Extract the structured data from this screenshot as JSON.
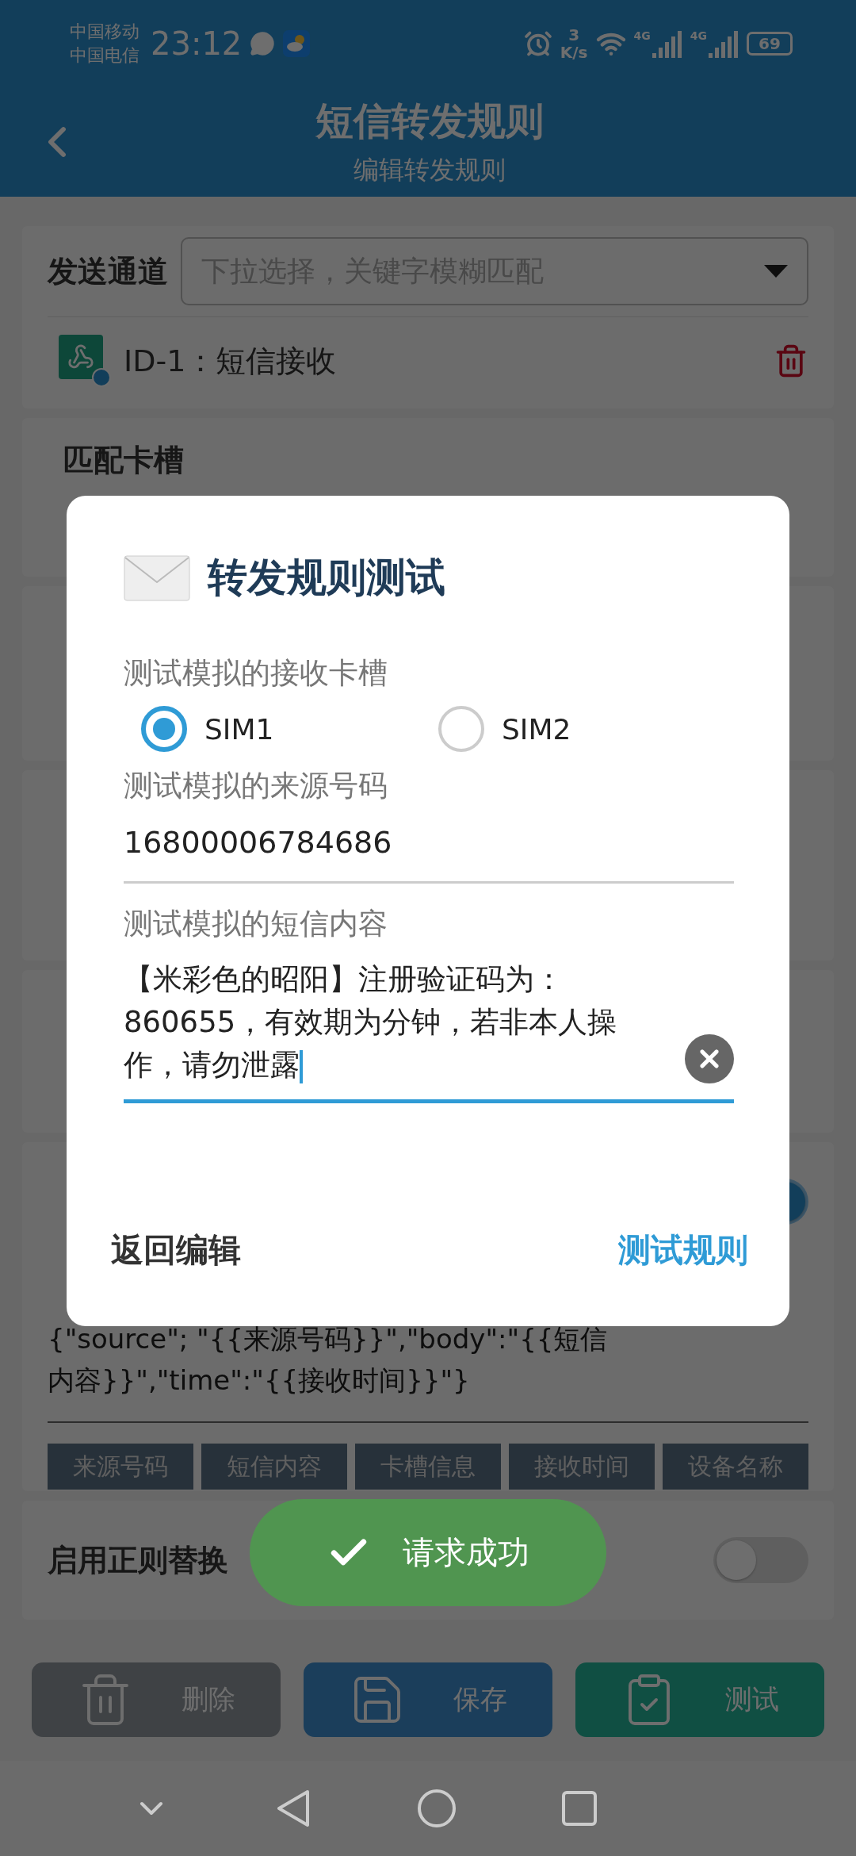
{
  "status_bar": {
    "carriers": [
      "中国移动",
      "中国电信"
    ],
    "time": "23:12",
    "net_speed": [
      "3",
      "K/s"
    ],
    "signals": [
      {
        "label": "4G"
      },
      {
        "label": "4G"
      }
    ],
    "battery": "69"
  },
  "header": {
    "title": "短信转发规则",
    "subtitle": "编辑转发规则"
  },
  "channel_card": {
    "label": "发送通道",
    "placeholder": "下拉选择，关键字模糊匹配",
    "items": [
      {
        "text": "ID-1：短信接收"
      }
    ]
  },
  "sim_card": {
    "title": "匹配卡槽"
  },
  "template_card": {
    "on": true,
    "template": "{\"source\"; \"{{来源号码}}\",\"body\":\"{{短信内容}}\",\"time\":\"{{接收时间}}\"}",
    "tags": [
      "来源号码",
      "短信内容",
      "卡槽信息",
      "接收时间",
      "设备名称"
    ]
  },
  "regex_card": {
    "title": "启用正则替换",
    "on": false
  },
  "actions": [
    {
      "label": "删除",
      "kind": "delete"
    },
    {
      "label": "保存",
      "kind": "save"
    },
    {
      "label": "测试",
      "kind": "test"
    }
  ],
  "dialog": {
    "title": "转发规则测试",
    "sim_label": "测试模拟的接收卡槽",
    "sims": [
      {
        "label": "SIM1",
        "selected": true
      },
      {
        "label": "SIM2",
        "selected": false
      }
    ],
    "number_label": "测试模拟的来源号码",
    "number": "16800006784686",
    "message_label": "测试模拟的短信内容",
    "message": "【米彩色的昭阳】注册验证码为：860655，有效期为分钟，若非本人操作，请勿泄露",
    "buttons": [
      {
        "label": "返回编辑",
        "kind": "cancel"
      },
      {
        "label": "测试规则",
        "kind": "confirm"
      }
    ]
  },
  "toast": {
    "text": "请求成功"
  }
}
